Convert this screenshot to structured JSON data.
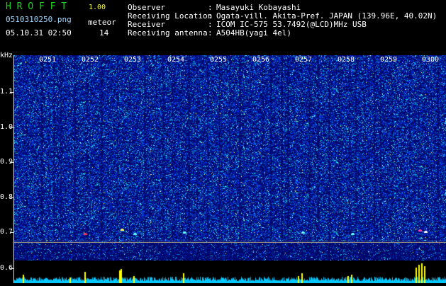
{
  "app": {
    "name": "H R O F F T",
    "version": "1.00"
  },
  "file": {
    "name": "0510310250.png",
    "datetime": "05.10.31 02:50"
  },
  "meteor": {
    "label": "meteor",
    "count": "14"
  },
  "info": [
    {
      "label": "Observer",
      "sep": ":",
      "value": "Masayuki Kobayashi"
    },
    {
      "label": "Receiving Location",
      "sep": ":",
      "value": "Ogata-vill. Akita-Pref. JAPAN (139.96E, 40.02N)"
    },
    {
      "label": "Receiver",
      "sep": ":",
      "value": "ICOM IC-575 53.7492(@LCD)MHz USB"
    },
    {
      "label": "Receiving antenna",
      "sep": ":",
      "value": "A504HB(yagi 4el)"
    }
  ],
  "axis": {
    "unit": "kHz",
    "y_ticks": [
      "1.1",
      "1.0",
      "0.9",
      "0.8",
      "0.7",
      "0.6"
    ],
    "time_ticks": [
      "0251",
      "0252",
      "0253",
      "0254",
      "0255",
      "0256",
      "0257",
      "0258",
      "0259",
      "0300"
    ]
  },
  "colors": {
    "title": "#1dd21d",
    "version": "#ffff33",
    "background": "#000c6e",
    "baseline": "#00c8ff",
    "peak": "#ffff00"
  }
}
